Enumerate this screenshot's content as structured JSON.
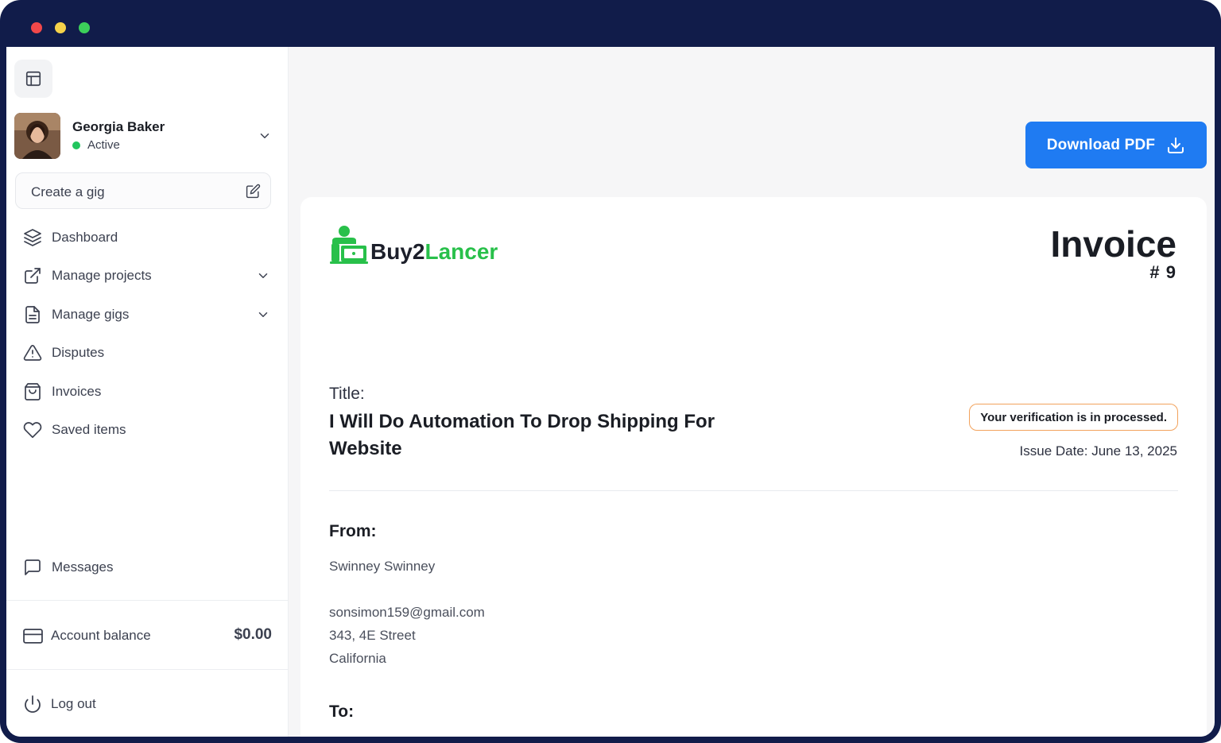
{
  "window": {
    "controls": [
      "close",
      "minimize",
      "maximize"
    ]
  },
  "sidebar": {
    "toggle_icon": "sidebar-layout-icon",
    "profile": {
      "name": "Georgia Baker",
      "status": "Active",
      "status_color": "#22c55e"
    },
    "create_gig": {
      "label": "Create a gig",
      "icon": "edit-icon"
    },
    "nav": [
      {
        "label": "Dashboard",
        "icon": "layers-icon"
      },
      {
        "label": "Manage projects",
        "icon": "external-link-icon",
        "has_submenu": true
      },
      {
        "label": "Manage gigs",
        "icon": "file-text-icon",
        "has_submenu": true
      },
      {
        "label": "Disputes",
        "icon": "alert-triangle-icon"
      },
      {
        "label": "Invoices",
        "icon": "shopping-bag-icon"
      },
      {
        "label": "Saved items",
        "icon": "heart-icon"
      }
    ],
    "messages": {
      "label": "Messages",
      "icon": "message-square-icon"
    },
    "balance": {
      "label": "Account balance",
      "amount": "$0.00",
      "icon": "credit-card-icon"
    },
    "logout": {
      "label": "Log out",
      "icon": "power-icon"
    }
  },
  "toolbar": {
    "download_label": "Download PDF",
    "download_icon": "download-icon",
    "accent": "#1f7bf2"
  },
  "invoice": {
    "logo": {
      "part1": "Buy2",
      "part2": "Lancer",
      "brand_color": "#28c04a"
    },
    "title": "Invoice",
    "number": "# 9",
    "title_label": "Title:",
    "gig_title": "I Will Do Automation To Drop Shipping For Website",
    "verification": "Your verification is in processed.",
    "issue_date": "Issue Date: June 13, 2025",
    "from_label": "From:",
    "from": {
      "name": "Swinney Swinney",
      "email": "sonsimon159@gmail.com",
      "street": "343, 4E Street",
      "region": "California"
    },
    "to_label": "To:"
  }
}
